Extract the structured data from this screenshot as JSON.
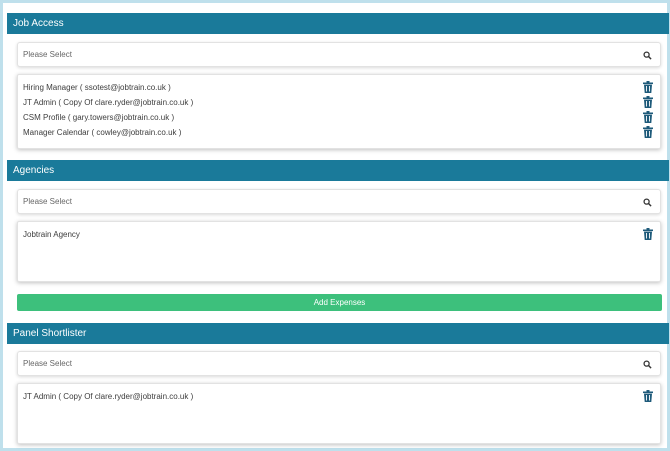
{
  "job_access": {
    "title": "Job Access",
    "placeholder": "Please Select",
    "items": [
      {
        "label": "Hiring Manager ( ssotest@jobtrain.co.uk )"
      },
      {
        "label": "JT Admin ( Copy Of clare.ryder@jobtrain.co.uk )"
      },
      {
        "label": "CSM Profile ( gary.towers@jobtrain.co.uk )"
      },
      {
        "label": "Manager Calendar ( cowley@jobtrain.co.uk )"
      }
    ]
  },
  "agencies": {
    "title": "Agencies",
    "placeholder": "Please Select",
    "items": [
      {
        "label": "Jobtrain Agency"
      }
    ]
  },
  "add_expenses_label": "Add Expenses",
  "panel_shortlister": {
    "title": "Panel Shortlister",
    "placeholder": "Please Select",
    "items": [
      {
        "label": "JT Admin ( Copy Of clare.ryder@jobtrain.co.uk )"
      }
    ]
  },
  "icons": {
    "search": "search-icon",
    "trash": "trash-icon"
  },
  "colors": {
    "header": "#1a7a9a",
    "button": "#3dc07c",
    "trash": "#1e5a7a",
    "frame_border": "#bfe0ec"
  }
}
